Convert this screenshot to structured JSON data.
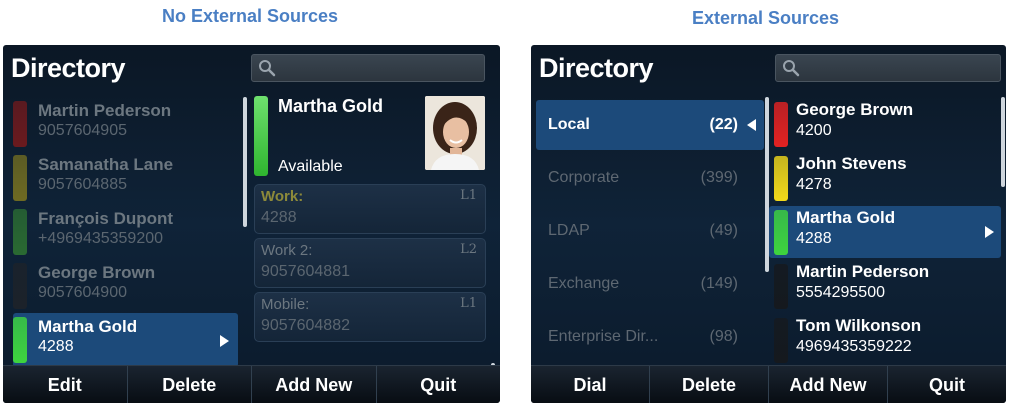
{
  "captions": {
    "left": "No External Sources",
    "right": "External Sources"
  },
  "left_screen": {
    "title": "Directory",
    "search": {
      "icon": "search-icon",
      "value": ""
    },
    "contacts": [
      {
        "name": "Martin Pederson",
        "number": "9057604905",
        "status_color": "#6b1a1e"
      },
      {
        "name": "Samanatha Lane",
        "number": "9057604885",
        "status_color": "#6e6a22"
      },
      {
        "name": "François Dupont",
        "number": "+4969435359200",
        "status_color": "#2a6a32"
      },
      {
        "name": "George Brown",
        "number": "9057604900",
        "status_color": "#1c222a"
      },
      {
        "name": "Martha Gold",
        "number": "4288",
        "status_color": "#3ed43e",
        "selected": true
      }
    ],
    "detail": {
      "name": "Martha Gold",
      "status": "Available",
      "status_color": "#3ed43e",
      "photo": "contact-photo",
      "numbers": [
        {
          "label": "Work:",
          "line": "L1",
          "value": "4288"
        },
        {
          "label": "Work 2:",
          "line": "L2",
          "value": "9057604881"
        },
        {
          "label": "Mobile:",
          "line": "L1",
          "value": "9057604882"
        }
      ]
    },
    "softkeys": [
      "Edit",
      "Delete",
      "Add New",
      "Quit"
    ]
  },
  "right_screen": {
    "title": "Directory",
    "search": {
      "icon": "search-icon",
      "value": ""
    },
    "sources": [
      {
        "name": "Local",
        "count": "(22)",
        "selected": true
      },
      {
        "name": "Corporate",
        "count": "(399)"
      },
      {
        "name": "LDAP",
        "count": "(49)"
      },
      {
        "name": "Exchange",
        "count": "(149)"
      },
      {
        "name": "Enterprise Dir...",
        "count": "(98)"
      }
    ],
    "contacts": [
      {
        "name": "George Brown",
        "number": "4200",
        "status_color": "#e32222"
      },
      {
        "name": "John Stevens",
        "number": "4278",
        "status_color": "#f2d91a"
      },
      {
        "name": "Martha Gold",
        "number": "4288",
        "status_color": "#3ed43e",
        "selected": true
      },
      {
        "name": "Martin Pederson",
        "number": "5554295500",
        "status_color": "#15191e"
      },
      {
        "name": "Tom Wilkonson",
        "number": "4969435359222",
        "status_color": "#15191e"
      }
    ],
    "softkeys": [
      "Dial",
      "Delete",
      "Add New",
      "Quit"
    ]
  }
}
